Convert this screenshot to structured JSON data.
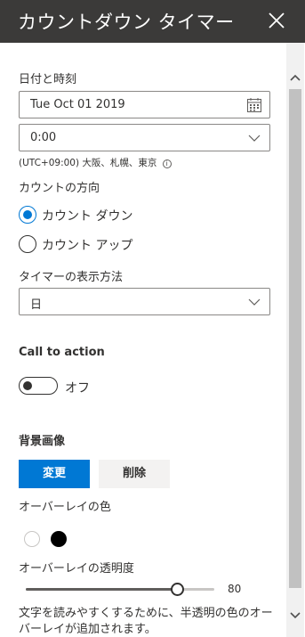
{
  "header": {
    "title": "カウントダウン タイマー"
  },
  "date_time": {
    "label": "日付と時刻",
    "date_value": "Tue Oct 01 2019",
    "time_value": "0:00",
    "timezone": "(UTC+09:00) 大阪、札幌、東京",
    "info_glyph": "i"
  },
  "direction": {
    "label": "カウントの方向",
    "options": [
      {
        "label": "カウント ダウン",
        "selected": true
      },
      {
        "label": "カウント アップ",
        "selected": false
      }
    ]
  },
  "display_mode": {
    "label": "タイマーの表示方法",
    "value": "日"
  },
  "call_to_action": {
    "label": "Call to action",
    "toggle_label": "オフ",
    "on": false
  },
  "background_image": {
    "label": "背景画像",
    "change_label": "変更",
    "delete_label": "削除"
  },
  "overlay_color": {
    "label": "オーバーレイの色",
    "swatches": [
      {
        "name": "white",
        "color": "#ffffff"
      },
      {
        "name": "black",
        "color": "#000000"
      }
    ],
    "selected": "black"
  },
  "overlay_opacity": {
    "label": "オーバーレイの透明度",
    "value": 80,
    "value_text": "80"
  },
  "description": "文字を読みやすくするために、半透明の色のオーバーレイが追加されます。",
  "colors": {
    "header_bg": "#3b3a39",
    "accent": "#0078d4"
  },
  "icons": {
    "close": "close-icon",
    "calendar": "calendar-icon",
    "chevron": "chevron-down-icon",
    "info": "info-icon"
  }
}
